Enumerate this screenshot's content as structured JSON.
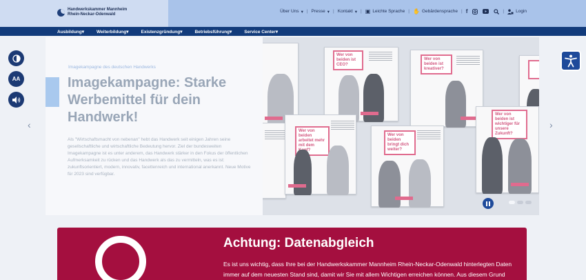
{
  "header": {
    "logo_line1": "Handwerkskammer Mannheim",
    "logo_line2": "Rhein-Neckar-Odenwald",
    "links": [
      {
        "label": "Über Uns",
        "has_dropdown": true
      },
      {
        "label": "Presse",
        "has_dropdown": true
      },
      {
        "label": "Kontakt",
        "has_dropdown": true
      },
      {
        "label": "Leichte Sprache",
        "icon": "easy-language-icon"
      },
      {
        "label": "Gebärdensprache",
        "icon": "sign-language-icon"
      }
    ],
    "social_icons": [
      "facebook-icon",
      "instagram-icon",
      "youtube-icon",
      "search-icon"
    ],
    "login_label": "Login"
  },
  "nav": {
    "items": [
      "Ausbildung",
      "Weiterbildung",
      "Existenzgründung",
      "Betriebsführung",
      "Service Center"
    ]
  },
  "accessibility": {
    "left_buttons": [
      {
        "icon": "contrast-icon"
      },
      {
        "label": "AA",
        "icon": "font-size-icon"
      },
      {
        "icon": "speaker-icon"
      }
    ],
    "badge_icon": "accessibility-person-icon"
  },
  "slide": {
    "eyebrow": "Imagekampagne des deutschen Handwerks",
    "title": "Imagekampagne: Starke Werbemittel für dein Handwerk!",
    "body": "Als \"Wirtschaftsmacht von nebenan\" hebt das Handwerk seit einigen Jahren seine gesellschaftliche und wirtschaftliche Bedeutung hervor. Ziel der bundesweiten Imagekampagne ist es unter anderem, das Handwerk stärker in den Fokus der öffentlichen Aufmerksamkeit zu rücken und das Handwerk als das zu vermitteln, was es ist: zukunftsorientiert, modern, innovativ, facettenreich und international anerkannt. Neue Motive für 2023 sind verfügbar.",
    "posters": [
      {
        "headline": "Wer von beiden ist CEO?"
      },
      {
        "headline": "Wer von beiden ist kreativer?"
      },
      {
        "headline": "Wer von beiden arbeitet mehr mit dem Kopf?"
      },
      {
        "headline": "Wer von beiden bringt dich weiter?"
      },
      {
        "headline": "Wer von beiden ist wichtiger für unsere Zukunft?"
      }
    ],
    "slide_count": 3,
    "active_slide": 1
  },
  "alert": {
    "title": "Achtung: Datenabgleich",
    "body": "Es ist uns wichtig, dass Ihre bei der Handwerkskammer Mannheim Rhein-Neckar-Odenwald hinterlegten Daten immer auf dem neuesten Stand sind, damit wir Sie mit allem Wichtigen erreichen können. Aus diesem Grund"
  }
}
